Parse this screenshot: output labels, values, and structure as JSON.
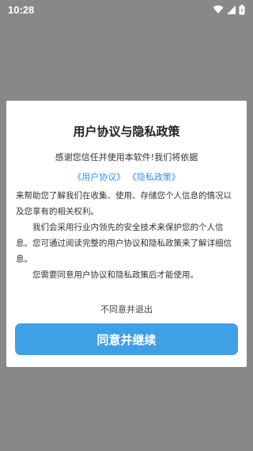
{
  "status_bar": {
    "time": "10:28"
  },
  "dialog": {
    "title": "用户协议与隐私政策",
    "thanks": "感谢您信任并使用本软件!我们将依据",
    "link_user_agreement": "《用户协议》",
    "link_privacy_policy": "《隐私政策》",
    "para1": "来帮助您了解我们在收集、使用、存储您个人信息的情况以及您享有的相关权利。",
    "para2": "我们会采用行业内领先的安全技术来保护您的个人信息。您可通过阅读完整的用户协议和隐私政策来了解详细信息。",
    "para3": "您需要同意用户协议和隐私政策后才能使用。",
    "decline_label": "不同意并退出",
    "agree_label": "同意并继续"
  },
  "colors": {
    "accent": "#3fa0e6",
    "link": "#3a8ee6",
    "overlay": "#888888"
  }
}
